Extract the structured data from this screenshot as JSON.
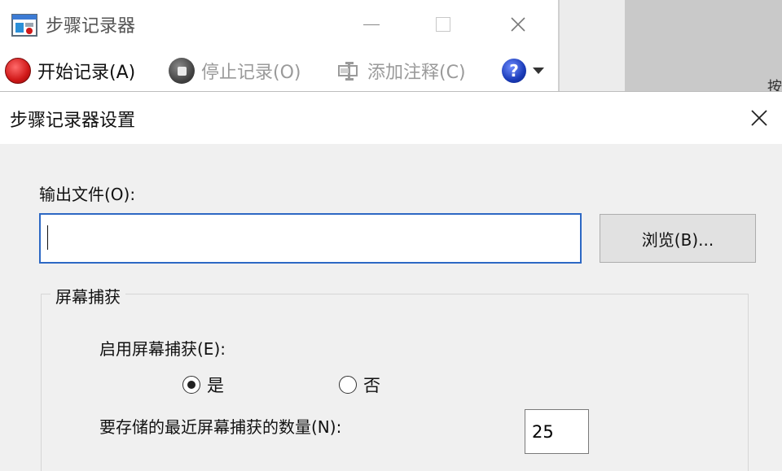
{
  "recorder": {
    "title": "步骤记录器",
    "toolbar": {
      "start_label": "开始记录(A)",
      "stop_label": "停止记录(O)",
      "note_label": "添加注释(C)",
      "help_label": "?"
    }
  },
  "background": {
    "edge_char": "按"
  },
  "dialog": {
    "title": "步骤记录器设置",
    "close_label": "✕",
    "output_label": "输出文件(O):",
    "output_value": "",
    "browse_label": "浏览(B)...",
    "capture_group": {
      "title": "屏幕捕获",
      "enable_label": "启用屏幕捕获(E):",
      "options": [
        {
          "label": "是",
          "checked": true
        },
        {
          "label": "否",
          "checked": false
        }
      ],
      "count_label": "要存储的最近屏幕捕获的数量(N):",
      "count_value": "25"
    }
  },
  "colors": {
    "accent_blue": "#2d68c4",
    "record_red": "#d01818",
    "dialog_bg": "#f0f0f0"
  }
}
